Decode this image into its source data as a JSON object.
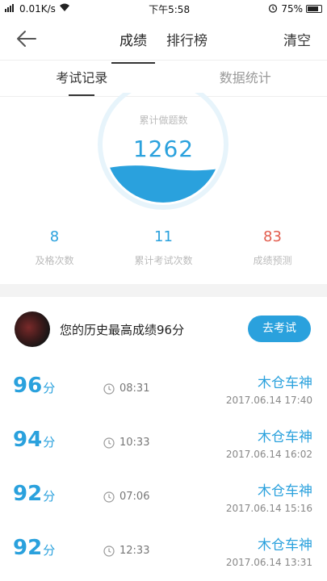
{
  "status_bar": {
    "net_speed": "0.01K/s",
    "time": "下午5:58",
    "battery": "75%"
  },
  "nav": {
    "tabs": [
      "成绩",
      "排行榜"
    ],
    "active_tab": 0,
    "clear_label": "清空"
  },
  "subtabs": [
    "考试记录",
    "数据统计"
  ],
  "gauge": {
    "label": "累计做题数",
    "value": "1262",
    "fill_fraction": 0.25,
    "color": "#2aa1dd"
  },
  "stats": [
    {
      "value": "8",
      "label": "及格次数"
    },
    {
      "value": "11",
      "label": "累计考试次数"
    },
    {
      "value": "83",
      "label": "成绩预测"
    }
  ],
  "best": {
    "text": "您的历史最高成绩96分",
    "button_label": "去考试"
  },
  "records": [
    {
      "score": "96",
      "unit": "分",
      "duration": "08:31",
      "name": "木仓车神",
      "date": "2017.06.14  17:40"
    },
    {
      "score": "94",
      "unit": "分",
      "duration": "10:33",
      "name": "木仓车神",
      "date": "2017.06.14  16:02"
    },
    {
      "score": "92",
      "unit": "分",
      "duration": "07:06",
      "name": "木仓车神",
      "date": "2017.06.14  15:16"
    },
    {
      "score": "92",
      "unit": "分",
      "duration": "12:33",
      "name": "木仓车神",
      "date": "2017.06.14  13:31"
    }
  ]
}
